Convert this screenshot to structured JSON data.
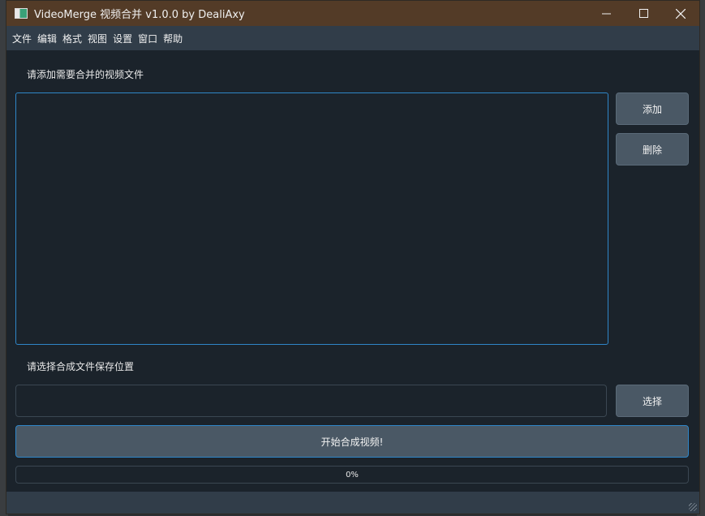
{
  "window": {
    "title": "VideoMerge 视频合并 v1.0.0 by DealiAxy",
    "controls": {
      "minimize": "—",
      "maximize": "☐",
      "close": "✕"
    }
  },
  "menubar": {
    "items": [
      "文件",
      "编辑",
      "格式",
      "视图",
      "设置",
      "窗口",
      "帮助"
    ]
  },
  "main": {
    "add_files_label": "请添加需要合并的视频文件",
    "add_button": "添加",
    "delete_button": "删除",
    "save_location_label": "请选择合成文件保存位置",
    "save_path_value": "",
    "select_button": "选择",
    "start_button": "开始合成视频!",
    "progress_text": "0%",
    "progress_value": 0
  },
  "colors": {
    "titlebar": "#533b27",
    "menubar": "#313d49",
    "body": "#1b232b",
    "button": "#4a5865",
    "accent": "#2f86c8"
  }
}
